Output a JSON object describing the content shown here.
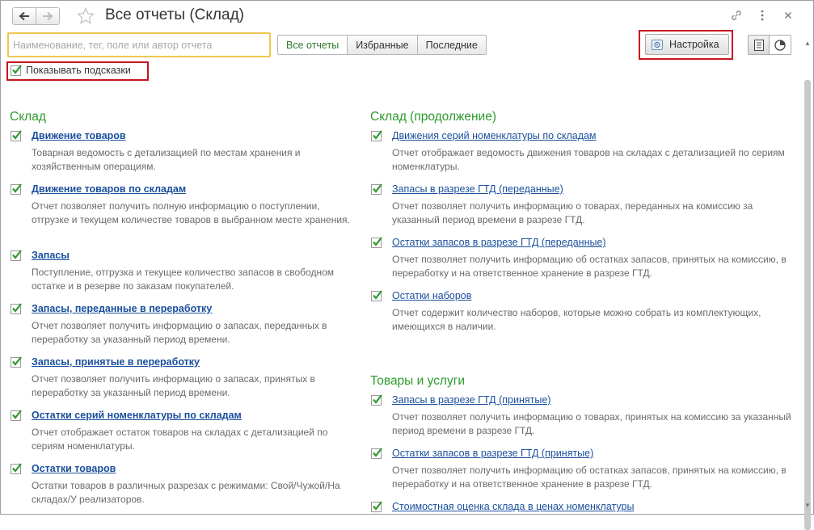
{
  "window": {
    "title": "Все отчеты (Склад)"
  },
  "toolbar": {
    "search_placeholder": "Наименование, тег, поле или автор отчета",
    "search_value": "",
    "filter_tabs": [
      "Все отчеты",
      "Избранные",
      "Последние"
    ],
    "settings_label": "Настройка",
    "show_hints_label": "Показывать подсказки",
    "show_hints_checked": true
  },
  "colors": {
    "section_title": "#2d9b2d",
    "link": "#1a4f9c",
    "highlight": "#c8141e",
    "search_focus": "#f0c650"
  },
  "left_section": {
    "title": "Склад",
    "items": [
      {
        "label": "Движение товаров",
        "description": "Товарная ведомость с детализацией по местам хранения и хозяйственным операциям.",
        "checked": true
      },
      {
        "label": "Движение товаров по складам",
        "description": "Отчет позволяет получить полную информацию о поступлении, отгрузке и текущем количестве товаров в выбранном месте хранения.",
        "checked": true
      },
      {
        "label": "Запасы",
        "description": "Поступление, отгрузка и текущее количество запасов в свободном остатке и в резерве по заказам покупателей.",
        "checked": true
      },
      {
        "label": "Запасы, переданные в переработку",
        "description": "Отчет позволяет получить информацию о запасах, переданных в переработку за указанный период времени.",
        "checked": true
      },
      {
        "label": "Запасы, принятые в переработку",
        "description": "Отчет позволяет получить информацию о запасах, принятых в переработку за указанный период времени.",
        "checked": true
      },
      {
        "label": "Остатки серий номенклатуры по складам",
        "description": "Отчет отображает остаток товаров на складах с детализацией по сериям номенклатуры.",
        "checked": true
      },
      {
        "label": "Остатки товаров",
        "description": "Остатки товаров в различных разрезах с режимами: Свой/Чужой/На складах/У реализаторов.",
        "checked": true
      }
    ]
  },
  "right_sections": [
    {
      "title": "Склад (продолжение)",
      "items": [
        {
          "label": "Движения серий номенклатуры по складам",
          "description": "Отчет отображает ведомость движения товаров на складах с детализацией по сериям номенклатуры.",
          "checked": true
        },
        {
          "label": "Запасы в разрезе ГТД (переданные)",
          "description": "Отчет позволяет получить информацию о товарах, переданных на комиссию за указанный период времени в разрезе ГТД.",
          "checked": true
        },
        {
          "label": "Остатки запасов в разрезе ГТД (переданные)",
          "description": "Отчет позволяет получить информацию об остатках запасов, принятых на комиссию, в переработку и на ответственное хранение в разрезе ГТД.",
          "checked": true
        },
        {
          "label": "Остатки наборов",
          "description": "Отчет содержит количество наборов, которые можно собрать из комплектующих, имеющихся в наличии.",
          "checked": true
        }
      ]
    },
    {
      "title": "Товары и услуги",
      "items": [
        {
          "label": "Запасы в разрезе ГТД (принятые)",
          "description": "Отчет позволяет получить информацию о товарах, принятых на комиссию за указанный период времени в разрезе ГТД.",
          "checked": true
        },
        {
          "label": "Остатки запасов в разрезе ГТД (принятые)",
          "description": "Отчет позволяет получить информацию об остатках запасов, принятых на комиссию, в переработку и на ответственное хранение в разрезе ГТД.",
          "checked": true
        },
        {
          "label": "Стоимостная оценка склада в ценах номенклатуры",
          "description": "",
          "checked": true
        }
      ]
    }
  ]
}
